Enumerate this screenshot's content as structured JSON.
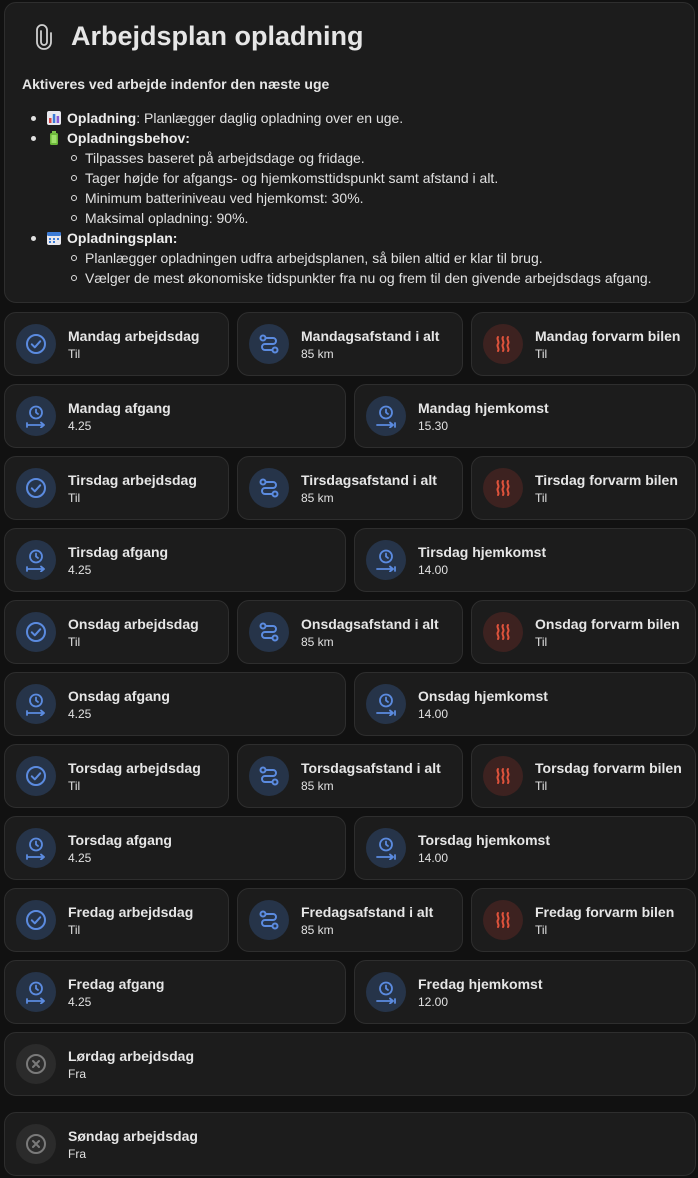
{
  "colors": {
    "blue": "#5b8be0",
    "red": "#e0533c",
    "grey": "#7a7a7a",
    "card": "#1c1c1c"
  },
  "header": {
    "title": "Arbejdsplan opladning",
    "subtitle": "Aktiveres ved arbejde indenfor den næste uge",
    "icon": "paperclip-icon"
  },
  "info": {
    "item1_label": "Opladning",
    "item1_text": ": Planlægger daglig opladning over en uge.",
    "item2_label": "Opladningsbehov",
    "item2_suffix": ":",
    "item2_sub": [
      "Tilpasses baseret på arbejdsdage og fridage.",
      "Tager højde for afgangs- og hjemkomsttidspunkt samt afstand i alt.",
      "Minimum batteriniveau ved hjemkomst: 30%.",
      "Maksimal opladning: 90%."
    ],
    "item3_label": "Opladningsplan",
    "item3_suffix": ":",
    "item3_sub": [
      "Planlægger opladningen udfra arbejdsplanen, så bilen altid er klar til brug.",
      "Vælger de mest økonomiske tidspunkter fra nu og frem til den givende arbejdsdags afgang."
    ]
  },
  "tiles": {
    "mon_work": {
      "name": "Mandag arbejdsdag",
      "state": "Til"
    },
    "mon_dist": {
      "name": "Mandagsafstand i alt",
      "state": "85 km"
    },
    "mon_heat": {
      "name": "Mandag forvarm bilen",
      "state": "Til"
    },
    "mon_dep": {
      "name": "Mandag afgang",
      "state": "4.25"
    },
    "mon_ret": {
      "name": "Mandag hjemkomst",
      "state": "15.30"
    },
    "tue_work": {
      "name": "Tirsdag arbejdsdag",
      "state": "Til"
    },
    "tue_dist": {
      "name": "Tirsdagsafstand i alt",
      "state": "85 km"
    },
    "tue_heat": {
      "name": "Tirsdag forvarm bilen",
      "state": "Til"
    },
    "tue_dep": {
      "name": "Tirsdag afgang",
      "state": "4.25"
    },
    "tue_ret": {
      "name": "Tirsdag hjemkomst",
      "state": "14.00"
    },
    "wed_work": {
      "name": "Onsdag arbejdsdag",
      "state": "Til"
    },
    "wed_dist": {
      "name": "Onsdagsafstand i alt",
      "state": "85 km"
    },
    "wed_heat": {
      "name": "Onsdag forvarm bilen",
      "state": "Til"
    },
    "wed_dep": {
      "name": "Onsdag afgang",
      "state": "4.25"
    },
    "wed_ret": {
      "name": "Onsdag hjemkomst",
      "state": "14.00"
    },
    "thu_work": {
      "name": "Torsdag arbejdsdag",
      "state": "Til"
    },
    "thu_dist": {
      "name": "Torsdagsafstand i alt",
      "state": "85 km"
    },
    "thu_heat": {
      "name": "Torsdag forvarm bilen",
      "state": "Til"
    },
    "thu_dep": {
      "name": "Torsdag afgang",
      "state": "4.25"
    },
    "thu_ret": {
      "name": "Torsdag hjemkomst",
      "state": "14.00"
    },
    "fri_work": {
      "name": "Fredag arbejdsdag",
      "state": "Til"
    },
    "fri_dist": {
      "name": "Fredagsafstand i alt",
      "state": "85 km"
    },
    "fri_heat": {
      "name": "Fredag forvarm bilen",
      "state": "Til"
    },
    "fri_dep": {
      "name": "Fredag afgang",
      "state": "4.25"
    },
    "fri_ret": {
      "name": "Fredag hjemkomst",
      "state": "12.00"
    },
    "sat_work": {
      "name": "Lørdag arbejdsdag",
      "state": "Fra"
    },
    "sun_work": {
      "name": "Søndag arbejdsdag",
      "state": "Fra"
    }
  }
}
